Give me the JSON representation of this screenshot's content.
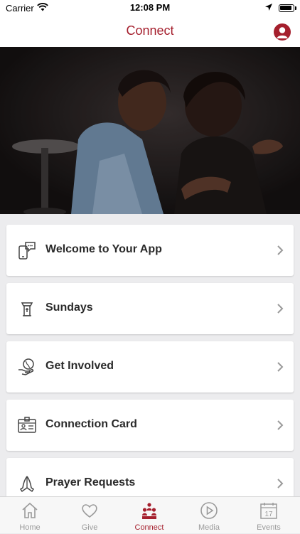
{
  "status_bar": {
    "carrier": "Carrier",
    "time": "12:08 PM"
  },
  "nav": {
    "title": "Connect"
  },
  "menu": {
    "items": [
      {
        "label": "Welcome to Your App",
        "icon": "phone-chat-icon"
      },
      {
        "label": "Sundays",
        "icon": "pulpit-icon"
      },
      {
        "label": "Get Involved",
        "icon": "globe-hand-icon"
      },
      {
        "label": "Connection Card",
        "icon": "id-card-icon"
      },
      {
        "label": "Prayer Requests",
        "icon": "praying-hands-icon"
      }
    ]
  },
  "tabs": [
    {
      "label": "Home",
      "icon": "home-icon",
      "active": false
    },
    {
      "label": "Give",
      "icon": "heart-icon",
      "active": false
    },
    {
      "label": "Connect",
      "icon": "people-icon",
      "active": true
    },
    {
      "label": "Media",
      "icon": "play-icon",
      "active": false
    },
    {
      "label": "Events",
      "icon": "calendar-icon",
      "active": false,
      "calendar_day": "17"
    }
  ],
  "colors": {
    "accent": "#a51f2d",
    "inactive": "#9a9a9a",
    "background": "#ececee"
  }
}
